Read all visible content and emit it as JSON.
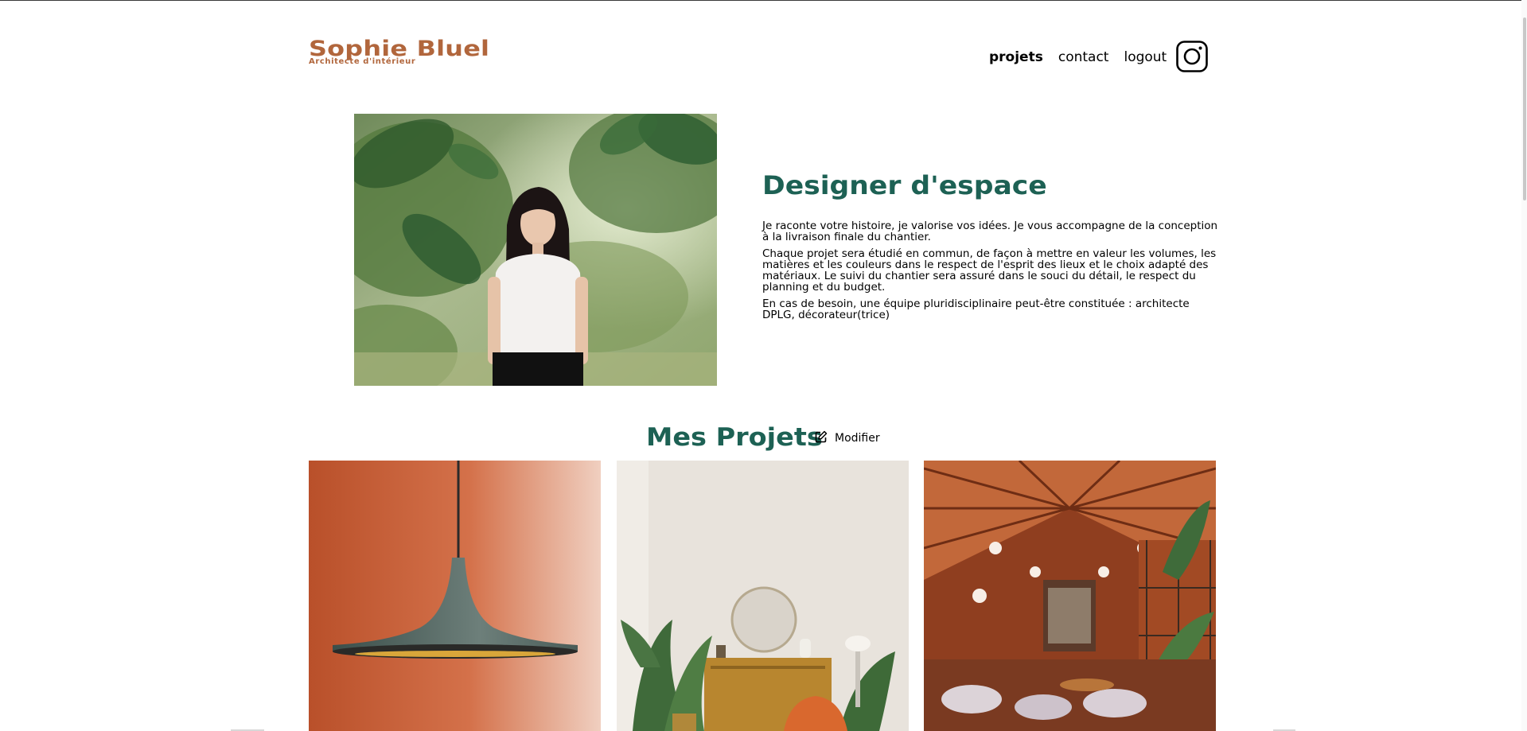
{
  "header": {
    "logo_title": "Sophie Bluel",
    "logo_subtitle": "Architecte d'intérieur",
    "nav": [
      {
        "label": "projets"
      },
      {
        "label": "contact"
      },
      {
        "label": "logout"
      }
    ],
    "instagram_icon": "instagram-icon"
  },
  "intro": {
    "photo": "portrait-photo",
    "title": "Designer d'espace",
    "paragraphs": [
      "Je raconte votre histoire, je valorise vos idées. Je vous accompagne de la conception à la livraison finale du chantier.",
      "Chaque projet sera étudié en commun, de façon à mettre en valeur les volumes, les matières et les couleurs dans le respect de l'esprit des lieux et le choix adapté des matériaux. Le suivi du chantier sera assuré dans le souci du détail, le respect du planning et du budget.",
      "En cas de besoin, une équipe pluridisciplinaire peut-être constituée : architecte DPLG, décorateur(trice)"
    ]
  },
  "projects": {
    "title": "Mes Projets",
    "edit_label": "Modifier",
    "edit_icon": "edit-icon",
    "gallery": [
      {
        "image": "pendant-lamp-photo"
      },
      {
        "image": "living-room-photo"
      },
      {
        "image": "restaurant-interior-photo"
      }
    ]
  },
  "colors": {
    "brand_orange": "#B1663C",
    "brand_green": "#1D6154"
  }
}
